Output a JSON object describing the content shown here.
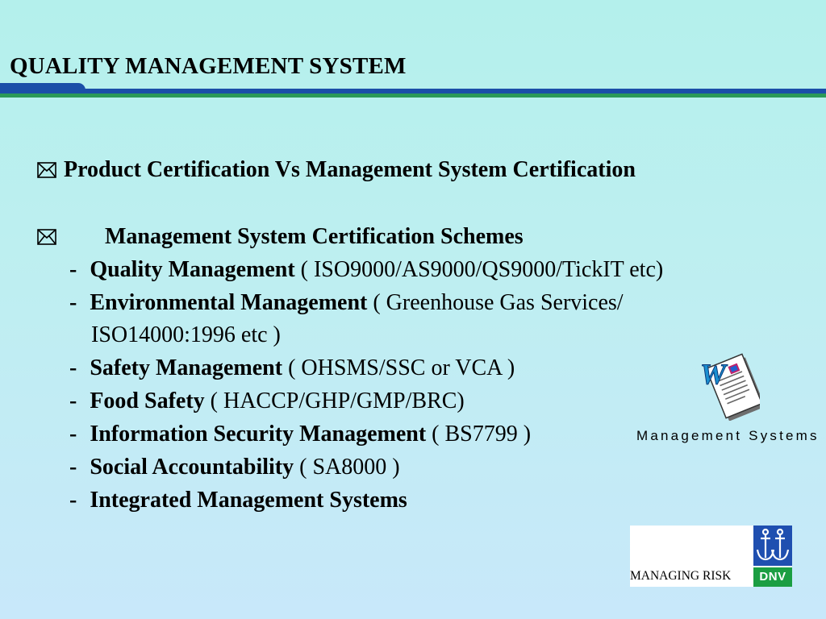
{
  "slide": {
    "title": "QUALITY MANAGEMENT SYSTEM",
    "colors": {
      "rule_blue": "#1b4fa8",
      "rule_green": "#2b9a58",
      "background": "#b8efee"
    }
  },
  "bullets": [
    {
      "icon": "envelope-icon",
      "text": "Product Certification Vs Management System Certification"
    },
    {
      "icon": "envelope-icon",
      "text": "Management System Certification Schemes"
    }
  ],
  "schemes": [
    {
      "dash": "-",
      "name": "Quality Management",
      "detail": " ( ISO9000/AS9000/QS9000/TickIT etc)"
    },
    {
      "dash": "-",
      "name": "Environmental Management",
      "detail": " ( Greenhouse Gas Services/",
      "detail_cont": "ISO14000:1996 etc )"
    },
    {
      "dash": "-",
      "name": "Safety Management",
      "detail": " ( OHSMS/SSC or VCA )"
    },
    {
      "dash": "-",
      "name": "Food Safety",
      "detail": " ( HACCP/GHP/GMP/BRC)"
    },
    {
      "dash": "-",
      "name": "Information Security Management",
      "detail": " ( BS7799 )"
    },
    {
      "dash": "-",
      "name": "Social Accountability",
      "detail": " ( SA8000 )"
    },
    {
      "dash": "-",
      "name": "Integrated Management Systems",
      "detail": ""
    }
  ],
  "clipart": {
    "icon": "word-document-icon",
    "caption": "Management Systems"
  },
  "logo": {
    "tagline": "MANAGING RISK",
    "brand": "DNV",
    "emblem_icon": "anchor-emblem-icon",
    "colors": {
      "emblem": "#1f4fb0",
      "brand_bar": "#1b9e42"
    }
  }
}
